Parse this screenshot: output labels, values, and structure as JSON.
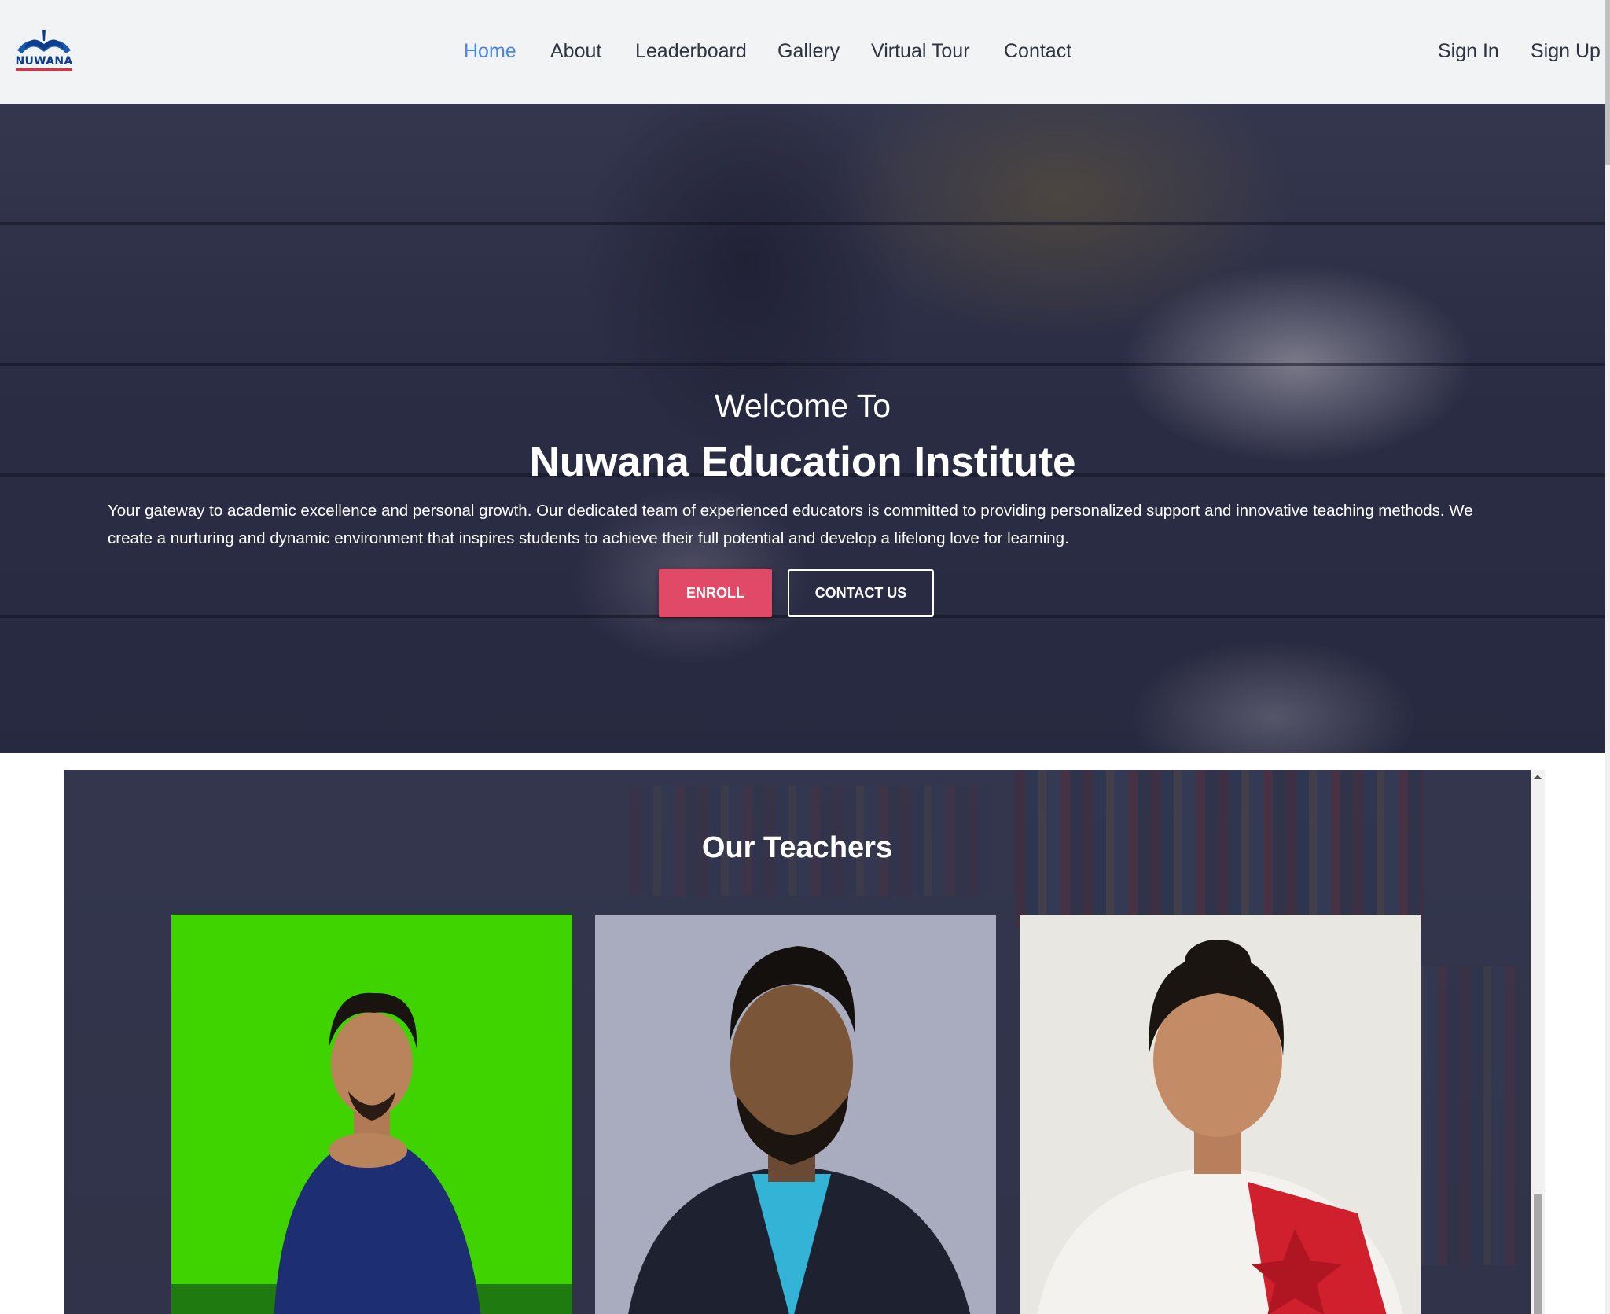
{
  "brand": {
    "logo_text": "NUWANA"
  },
  "nav": {
    "items": [
      {
        "label": "Home",
        "active": true
      },
      {
        "label": "About"
      },
      {
        "label": "Leaderboard"
      },
      {
        "label": "Gallery"
      },
      {
        "label": "Virtual Tour"
      },
      {
        "label": "Contact"
      }
    ],
    "sign_in": "Sign In",
    "sign_up": "Sign Up"
  },
  "hero": {
    "welcome": "Welcome To",
    "title": "Nuwana Education Institute",
    "description": "Your gateway to academic excellence and personal growth. Our dedicated team of experienced educators is committed to providing personalized support and innovative teaching methods. We create a nurturing and dynamic environment that inspires students to achieve their full potential and develop a lifelong love for learning.",
    "enroll_label": "ENROLL",
    "contact_label": "CONTACT US"
  },
  "teachers": {
    "title": "Our Teachers",
    "cards": [
      {
        "photo": "teacher-photo-green-background"
      },
      {
        "photo": "teacher-photo-grey-background"
      },
      {
        "photo": "teacher-photo-white-background"
      }
    ]
  },
  "colors": {
    "nav_active": "#4a86e8",
    "enroll_button": "#e04a66",
    "header_bg": "#f1f3f5"
  }
}
